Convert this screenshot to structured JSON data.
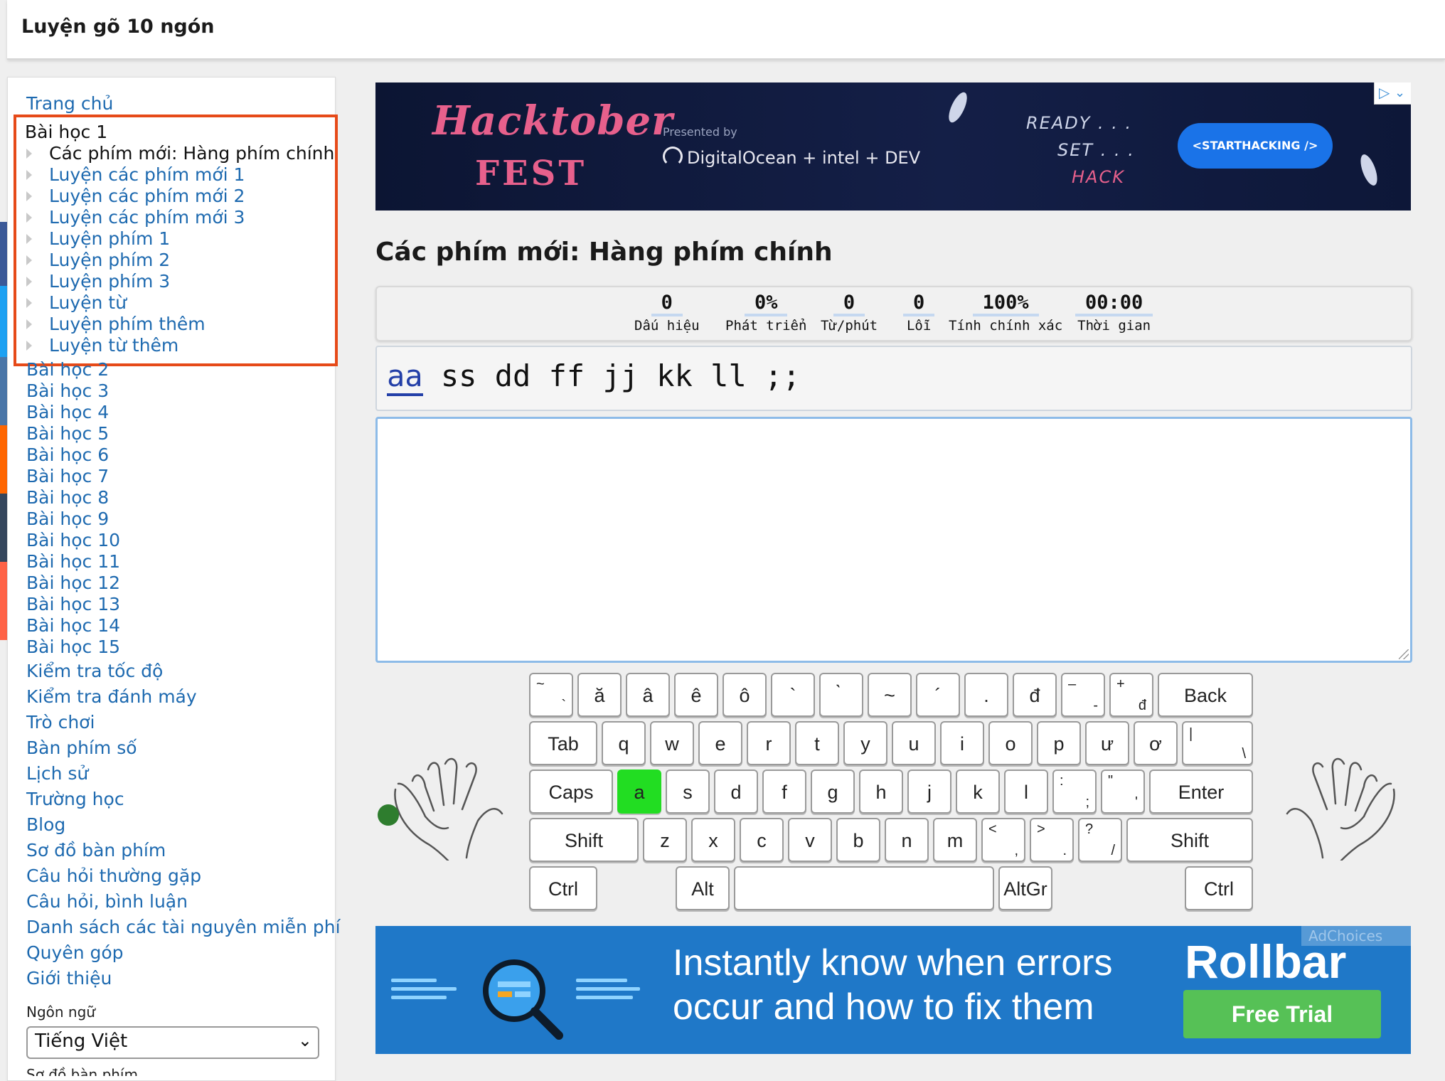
{
  "app": {
    "title": "Luyện gõ 10 ngón"
  },
  "sidebar": {
    "home": "Trang chủ",
    "current_lesson": {
      "title": "Bài học 1",
      "items": [
        "Các phím mới: Hàng phím chính",
        "Luyện các phím mới 1",
        "Luyện các phím mới 2",
        "Luyện các phím mới 3",
        "Luyện phím 1",
        "Luyện phím 2",
        "Luyện phím 3",
        "Luyện từ",
        "Luyện phím thêm",
        "Luyện từ thêm"
      ]
    },
    "lessons": [
      "Bài học 2",
      "Bài học 3",
      "Bài học 4",
      "Bài học 5",
      "Bài học 6",
      "Bài học 7",
      "Bài học 8",
      "Bài học 9",
      "Bài học 10",
      "Bài học 11",
      "Bài học 12",
      "Bài học 13",
      "Bài học 14",
      "Bài học 15"
    ],
    "links": [
      "Kiểm tra tốc độ",
      "Kiểm tra đánh máy",
      "Trò chơi",
      "Bàn phím số",
      "Lịch sử",
      "Trường học",
      "Blog",
      "Sơ đồ bàn phím",
      "Câu hỏi thường gặp",
      "Câu hỏi, bình luận",
      "Danh sách các tài nguyên miễn phí",
      "Quyên góp",
      "Giới thiệu"
    ],
    "language_label": "Ngôn ngữ",
    "language_value": "Tiếng Việt",
    "cut_label": "Sơ đồ bàn phím"
  },
  "ad_top": {
    "logo_line1": "Hacktober",
    "logo_line2": "FEST",
    "presented_by": "Presented by",
    "sponsors": "DigitalOcean + intel + DEV",
    "ready": "READY . . .",
    "set": "SET . . .",
    "hack": "HACK",
    "cta": "<STARTHACKING />"
  },
  "lesson": {
    "title": "Các phím mới: Hàng phím chính",
    "text_current": "aa",
    "text_rest": " ss dd ff jj kk ll ;;",
    "input_value": ""
  },
  "stats": [
    {
      "value": "0",
      "label": "Dấu hiệu"
    },
    {
      "value": "0%",
      "label": "Phát triển"
    },
    {
      "value": "0",
      "label": "Từ/phút"
    },
    {
      "value": "0",
      "label": "Lỗi"
    },
    {
      "value": "100%",
      "label": "Tính chính xác"
    },
    {
      "value": "00:00",
      "label": "Thời gian"
    }
  ],
  "keyboard": {
    "row1": [
      {
        "label": "",
        "sup": "~",
        "sub": "`"
      },
      {
        "label": "ă"
      },
      {
        "label": "â"
      },
      {
        "label": "ê"
      },
      {
        "label": "ô"
      },
      {
        "label": "`"
      },
      {
        "label": "̀"
      },
      {
        "label": "~"
      },
      {
        "label": "´"
      },
      {
        "label": "."
      },
      {
        "label": "đ"
      },
      {
        "label": "",
        "sup": "–",
        "sub": "-"
      },
      {
        "label": "",
        "sup": "+",
        "sub": "đ"
      },
      {
        "label": "Back"
      }
    ],
    "row2": [
      {
        "label": "Tab"
      },
      {
        "label": "q"
      },
      {
        "label": "w"
      },
      {
        "label": "e"
      },
      {
        "label": "r"
      },
      {
        "label": "t"
      },
      {
        "label": "y"
      },
      {
        "label": "u"
      },
      {
        "label": "i"
      },
      {
        "label": "o"
      },
      {
        "label": "p"
      },
      {
        "label": "ư"
      },
      {
        "label": "ơ"
      },
      {
        "label": "",
        "sup": "|",
        "sub": "\\"
      }
    ],
    "row3": [
      {
        "label": "Caps"
      },
      {
        "label": "a",
        "highlight": true
      },
      {
        "label": "s"
      },
      {
        "label": "d"
      },
      {
        "label": "f"
      },
      {
        "label": "g"
      },
      {
        "label": "h"
      },
      {
        "label": "j"
      },
      {
        "label": "k"
      },
      {
        "label": "l"
      },
      {
        "label": "",
        "sup": ":",
        "sub": ";"
      },
      {
        "label": "",
        "sup": "\"",
        "sub": "'"
      },
      {
        "label": "Enter"
      }
    ],
    "row4": [
      {
        "label": "Shift"
      },
      {
        "label": "z"
      },
      {
        "label": "x"
      },
      {
        "label": "c"
      },
      {
        "label": "v"
      },
      {
        "label": "b"
      },
      {
        "label": "n"
      },
      {
        "label": "m"
      },
      {
        "label": "",
        "sup": "<",
        "sub": ","
      },
      {
        "label": "",
        "sup": ">",
        "sub": "."
      },
      {
        "label": "",
        "sup": "?",
        "sub": "/"
      },
      {
        "label": "Shift"
      }
    ],
    "row5": [
      {
        "label": "Ctrl"
      },
      {
        "label": "Alt"
      },
      {
        "label": ""
      },
      {
        "label": "AltGr"
      },
      {
        "label": "Ctrl"
      }
    ],
    "highlight_color": "#22dd22"
  },
  "ad_bottom": {
    "line1": "Instantly know when errors",
    "line2": "occur and how to fix them",
    "brand": "Rollbar",
    "cta": "Free Trial",
    "adchoices": "AdChoices"
  },
  "colors": {
    "link": "#1e6ab0",
    "highlight_box": "#e64a19",
    "ad_bottom_bg": "#1f78c8"
  }
}
